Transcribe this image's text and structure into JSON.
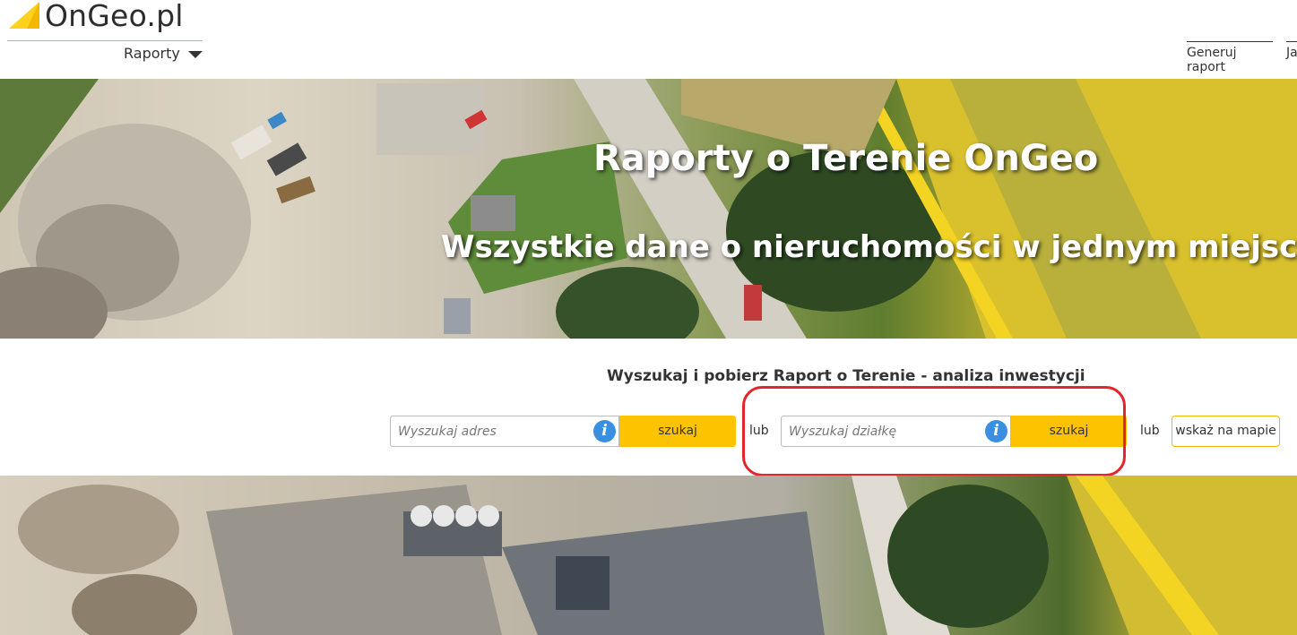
{
  "header": {
    "logo_text": "OnGeo.pl",
    "menu_label": "Raporty",
    "nav_generate": "Generuj raport",
    "nav_partial": "Ja"
  },
  "hero": {
    "title": "Raporty o Terenie OnGeo",
    "subtitle": "Wszystkie dane o nieruchomości w jednym miejscu"
  },
  "search": {
    "heading": "Wyszukaj i pobierz Raport o Terenie - analiza inwestycji",
    "address_placeholder": "Wyszukaj adres",
    "address_button": "szukaj",
    "or1": "lub",
    "parcel_placeholder": "Wyszukaj działkę",
    "parcel_button": "szukaj",
    "or2": "lub",
    "map_button": "wskaż na mapie",
    "info_glyph": "i"
  },
  "colors": {
    "accent": "#fdc300",
    "info": "#3b8fe0",
    "highlight": "#e3262c"
  },
  "icons": [
    "logo-triangle-icon",
    "chevron-down-icon",
    "info-icon"
  ]
}
